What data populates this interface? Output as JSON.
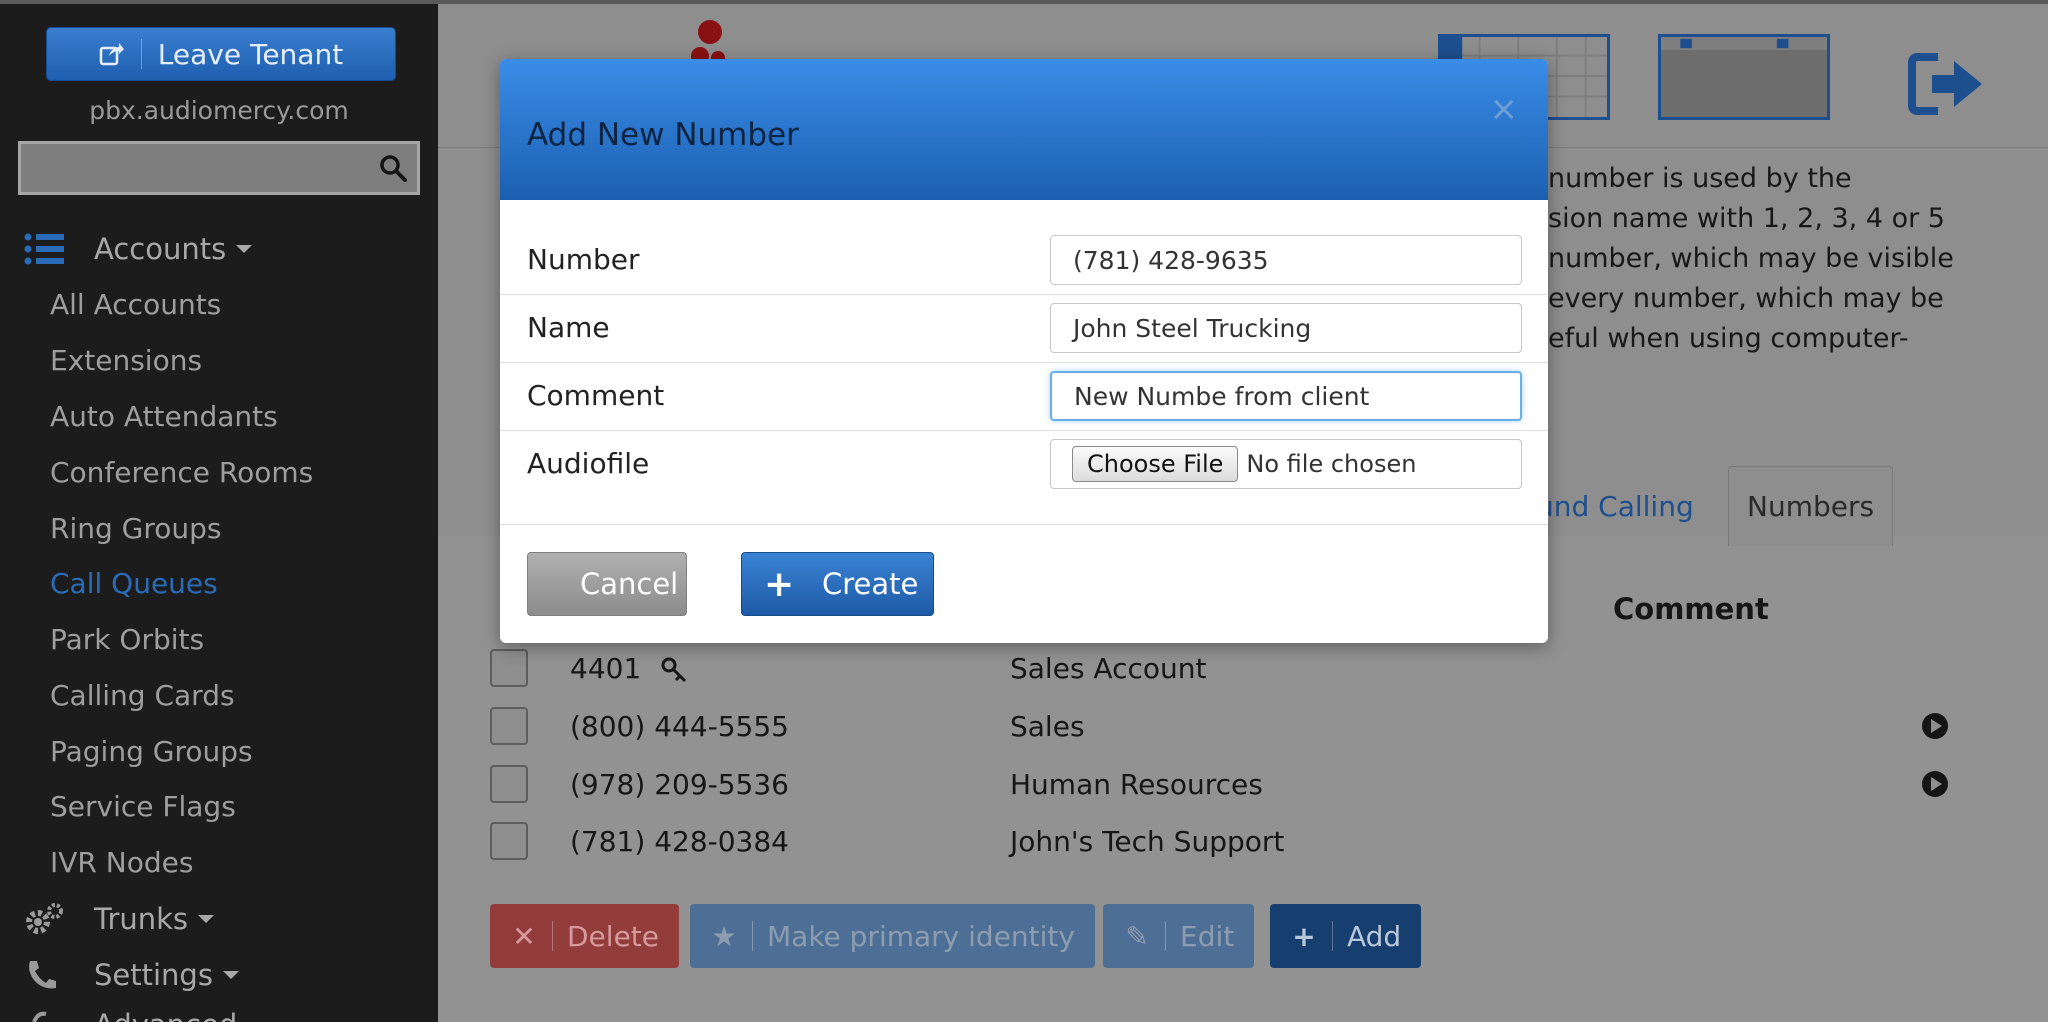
{
  "sidebar": {
    "leave_tenant_label": "Leave Tenant",
    "tenant_domain": "pbx.audiomercy.com",
    "search_placeholder": "",
    "accounts_header": "Accounts",
    "items": [
      {
        "label": "All Accounts"
      },
      {
        "label": "Extensions"
      },
      {
        "label": "Auto Attendants"
      },
      {
        "label": "Conference Rooms"
      },
      {
        "label": "Ring Groups"
      },
      {
        "label": "Call Queues"
      },
      {
        "label": "Park Orbits"
      },
      {
        "label": "Calling Cards"
      },
      {
        "label": "Paging Groups"
      },
      {
        "label": "Service Flags"
      },
      {
        "label": "IVR Nodes"
      }
    ],
    "trunks_header": "Trunks",
    "settings_header": "Settings",
    "advanced_header": "Advanced"
  },
  "page": {
    "description_lines": [
      "number is used by the",
      "sion name with 1, 2, 3, 4 or 5",
      "number, which may be visible",
      "every number, which may be",
      "eful when using computer-"
    ],
    "tab_outbound": "und Calling",
    "tab_numbers": "Numbers",
    "comment_header": "Comment",
    "rows": [
      {
        "number": "4401",
        "name": "Sales Account"
      },
      {
        "number": "(800) 444-5555",
        "name": "Sales"
      },
      {
        "number": "(978) 209-5536",
        "name": "Human Resources"
      },
      {
        "number": "(781) 428-0384",
        "name": "John's Tech Support"
      }
    ],
    "delete_label": "Delete",
    "primary_label": "Make primary identity",
    "edit_label": "Edit",
    "add_label": "Add"
  },
  "modal": {
    "title": "Add New Number",
    "close": "×",
    "number_label": "Number",
    "number_value": "(781) 428-9635",
    "name_label": "Name",
    "name_value": "John Steel Trucking",
    "comment_label": "Comment",
    "comment_value": "New Numbe from client",
    "audiofile_label": "Audiofile",
    "choose_file_label": "Choose File",
    "no_file_label": "No file chosen",
    "cancel_label": "Cancel",
    "create_label": "Create"
  },
  "colors": {
    "modal_header": "#2f7ad6",
    "active_nav": "#2a6bb8",
    "sidebar_bg": "#1c1c1c",
    "delete_btn": "#c9302c",
    "primary_btn": "#337ab7"
  }
}
